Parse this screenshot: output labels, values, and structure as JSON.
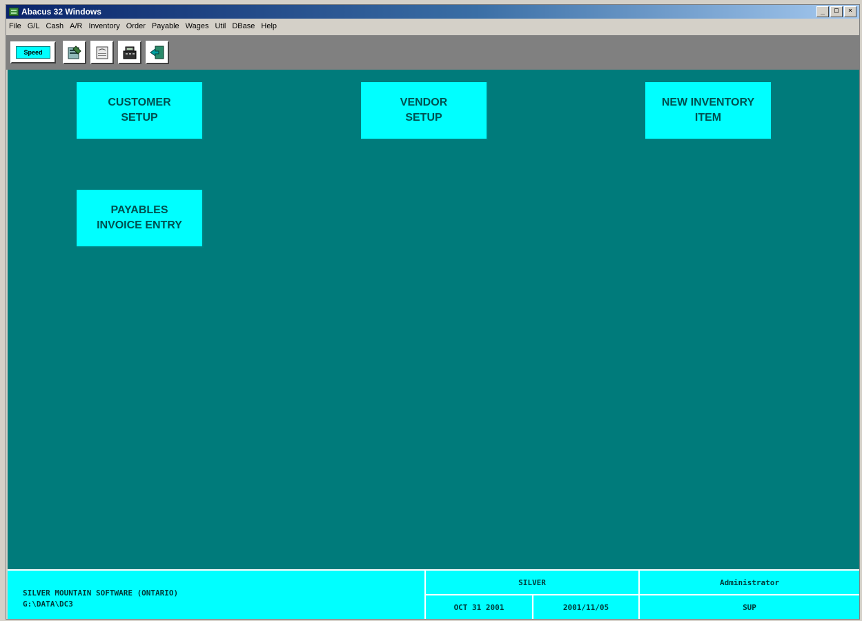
{
  "window": {
    "title": "Abacus 32 Windows"
  },
  "window_buttons": [
    "_",
    "□",
    "×"
  ],
  "menu": [
    "File",
    "G/L",
    "Cash",
    "A/R",
    "Inventory",
    "Order",
    "Payable",
    "Wages",
    "Util",
    "DBase",
    "Help"
  ],
  "toolbar": {
    "speed_label": "Speed",
    "buttons": [
      {
        "icon": "ledger-pen-icon"
      },
      {
        "icon": "notepad-icon"
      },
      {
        "icon": "cash-register-icon"
      },
      {
        "icon": "exit-door-icon"
      }
    ]
  },
  "speed_tiles": {
    "customer_setup": {
      "line1": "CUSTOMER",
      "line2": "SETUP"
    },
    "vendor_setup": {
      "line1": "VENDOR",
      "line2": "SETUP"
    },
    "new_inventory_item": {
      "line1": "NEW INVENTORY",
      "line2": "ITEM"
    },
    "payables_invoice_entry": {
      "line1": "PAYABLES",
      "line2": "INVOICE ENTRY"
    }
  },
  "status": {
    "company": "SILVER MOUNTAIN SOFTWARE (ONTARIO)",
    "path": "G:\\DATA\\DC3",
    "code": "SILVER",
    "user": "Administrator",
    "period_date": "OCT 31 2001",
    "system_date": "2001/11/05",
    "user_id": "SUP"
  },
  "colors": {
    "desktop_teal": "#007b7b",
    "tile_cyan": "#00ffff",
    "tile_text": "#005050",
    "titlebar": "#0a246a"
  }
}
